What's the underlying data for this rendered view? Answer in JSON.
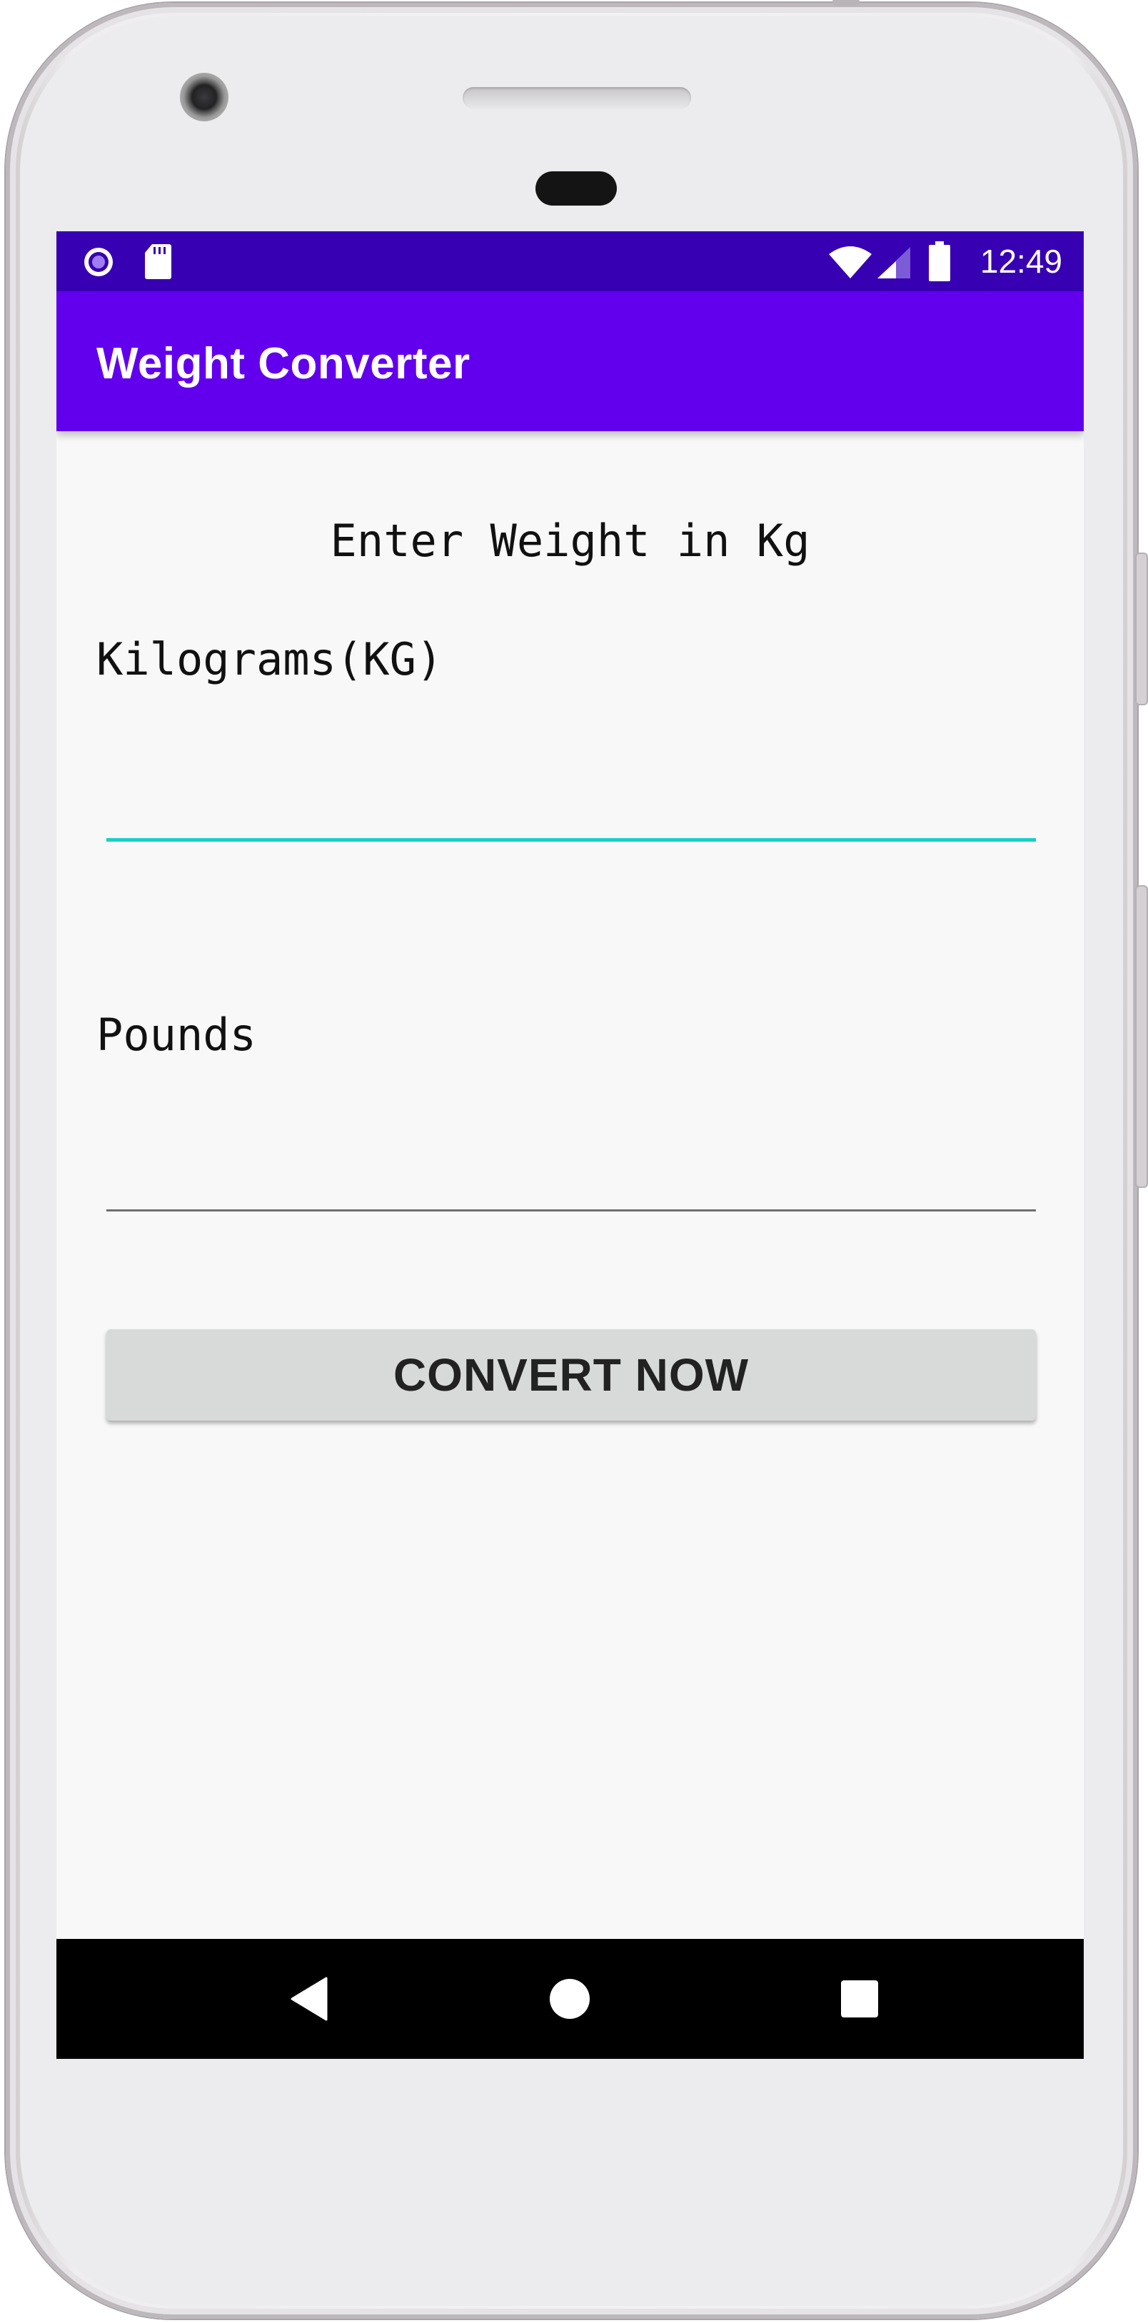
{
  "status_bar": {
    "time": "12:49",
    "left_icons": [
      "media-record-icon",
      "sd-card-icon"
    ],
    "right_icons": [
      "wifi-icon",
      "cell-signal-icon",
      "battery-icon"
    ]
  },
  "app_bar": {
    "title": "Weight Converter"
  },
  "form": {
    "heading": "Enter Weight in Kg",
    "kg_label": "Kilograms(KG)",
    "kg_value": "",
    "lb_label": "Pounds",
    "lb_value": "",
    "convert_button_label": "CONVERT NOW"
  },
  "nav_bar": {
    "buttons": [
      "back-icon",
      "home-icon",
      "recents-icon"
    ]
  },
  "colors": {
    "status_bar": "#3700b3",
    "app_bar": "#6200ee",
    "focused_field_line": "#18d0c8",
    "button_bg": "#d8d9d9"
  }
}
